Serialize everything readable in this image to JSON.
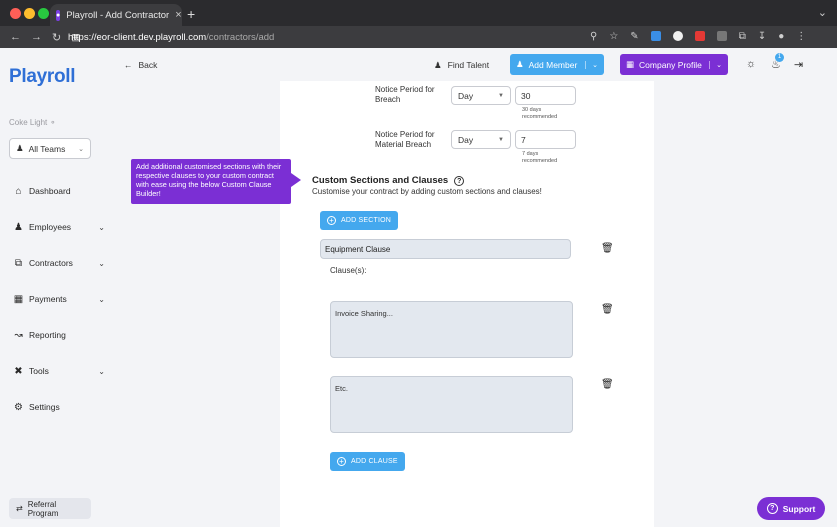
{
  "browser": {
    "tab_title": "Playroll - Add Contractor",
    "url_host": "https://eor-client.dev.playroll.com",
    "url_path": "/contractors/add"
  },
  "sidebar": {
    "logo": "Playroll",
    "company": "Coke Light",
    "teams_label": "All Teams",
    "items": [
      {
        "label": "Dashboard",
        "icon": "home-icon"
      },
      {
        "label": "Employees",
        "icon": "people-icon"
      },
      {
        "label": "Contractors",
        "icon": "contract-icon"
      },
      {
        "label": "Payments",
        "icon": "payments-icon"
      },
      {
        "label": "Reporting",
        "icon": "chart-line-icon"
      },
      {
        "label": "Tools",
        "icon": "tools-icon"
      },
      {
        "label": "Settings",
        "icon": "gear-icon"
      }
    ],
    "referral": "Referral Program"
  },
  "topbar": {
    "back": "Back",
    "find_talent": "Find Talent",
    "add_member": "Add Member",
    "company_profile": "Company Profile",
    "notif_count": "1"
  },
  "form": {
    "notice_breach": {
      "label_line1": "Notice Period for",
      "label_line2": "Breach",
      "unit": "Day",
      "value": "30",
      "hint_line1": "30 days",
      "hint_line2": "recommended"
    },
    "notice_material": {
      "label_line1": "Notice Period for",
      "label_line2": "Material Breach",
      "unit": "Day",
      "value": "7",
      "hint_line1": "7 days",
      "hint_line2": "recommended"
    },
    "section_title": "Custom Sections and Clauses",
    "section_sub": "Customise your contract by adding custom sections and clauses!",
    "add_section": "ADD SECTION",
    "clause_title": "Equipment Clause",
    "clauses_label": "Clause(s):",
    "clause_1": "Invoice Sharing...",
    "clause_2": "Etc.",
    "add_clause": "ADD CLAUSE"
  },
  "tooltip": "Add additional customised sections with their respective clauses to your custom contract with ease using the below Custom Clause Builder!",
  "support": "Support",
  "colors": {
    "brand_blue": "#44a8ee",
    "brand_purple": "#7b2fd4",
    "logo_blue": "#2f6fd6"
  }
}
